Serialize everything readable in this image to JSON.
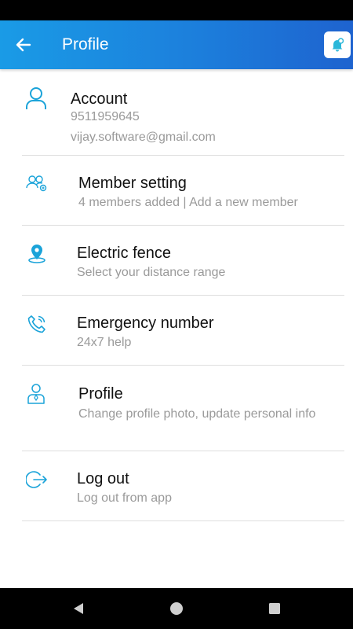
{
  "appbar": {
    "title": "Profile",
    "back_icon": "arrow-back-icon",
    "notification_icon": "bell-icon"
  },
  "colors": {
    "appbar_start": "#1a9be6",
    "appbar_end": "#1e63cf",
    "icon_accent": "#1aa3d9"
  },
  "account": {
    "title": "Account",
    "phone": "9511959645",
    "email": "vijay.software@gmail.com",
    "icon": "user-icon"
  },
  "member_setting": {
    "title": "Member setting",
    "subtitle": "4 members added | Add a new member",
    "icon": "users-group-icon"
  },
  "electric_fence": {
    "title": "Electric fence",
    "subtitle": "Select your distance range",
    "icon": "map-pin-icon"
  },
  "emergency_number": {
    "title": "Emergency number",
    "subtitle": "24x7 help",
    "icon": "phone-call-icon"
  },
  "profile": {
    "title": "Profile",
    "subtitle": "Change profile photo, update personal info",
    "icon": "person-id-icon"
  },
  "logout": {
    "title": "Log out",
    "subtitle": "Log out from app",
    "icon": "logout-icon"
  },
  "navbar": {
    "back_icon": "nav-back-icon",
    "home_icon": "nav-home-icon",
    "recents_icon": "nav-recents-icon"
  }
}
